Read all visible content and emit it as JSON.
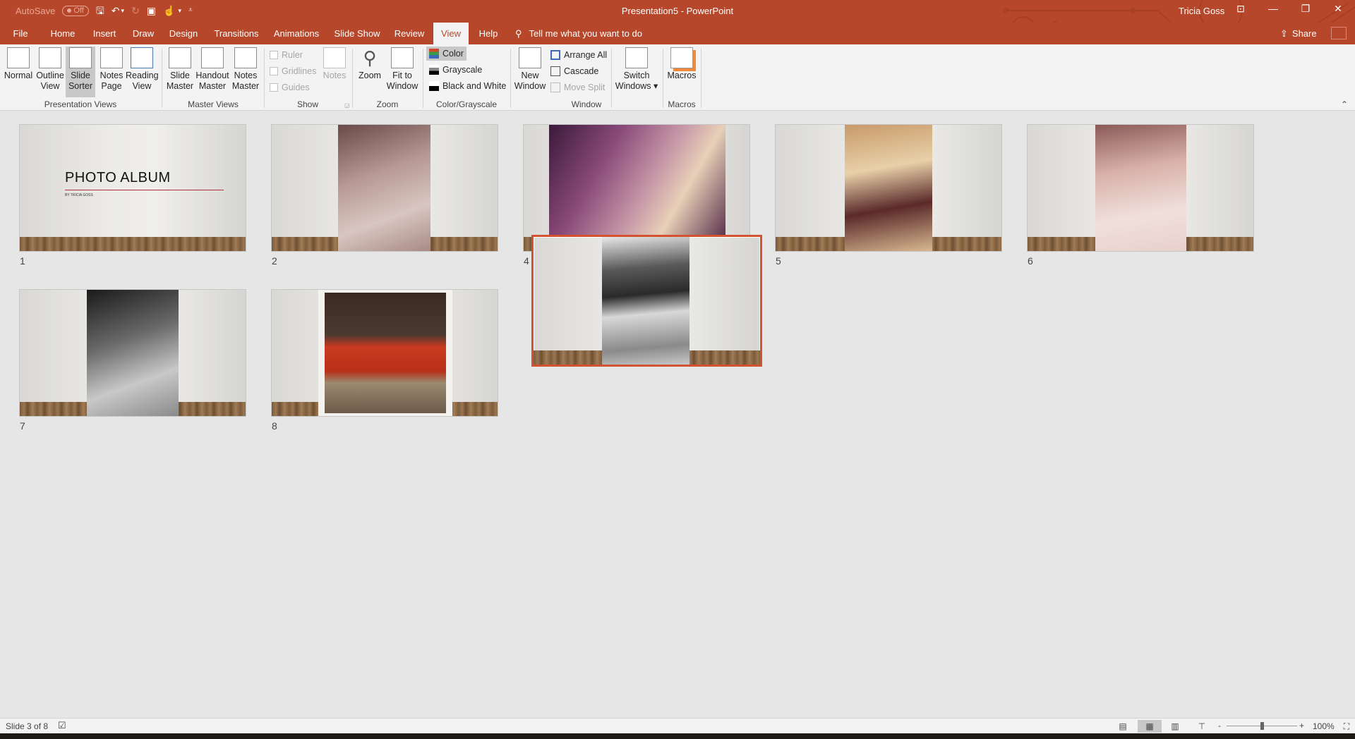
{
  "window": {
    "title": "Presentation5  -  PowerPoint",
    "user": "Tricia Goss",
    "autosave_label": "AutoSave",
    "autosave_state": "Off",
    "controls": {
      "ribbon_display": "⊡",
      "minimize": "—",
      "restore": "❐",
      "close": "✕"
    }
  },
  "qat": {
    "save": "🖫",
    "undo": "↶",
    "undo_dd": "▾",
    "redo": "↻",
    "present": "▣",
    "touch": "☝",
    "touch_dd": "▾",
    "customize": "⩡"
  },
  "tabs": [
    {
      "label": "File"
    },
    {
      "label": "Home"
    },
    {
      "label": "Insert"
    },
    {
      "label": "Draw"
    },
    {
      "label": "Design"
    },
    {
      "label": "Transitions"
    },
    {
      "label": "Animations"
    },
    {
      "label": "Slide Show"
    },
    {
      "label": "Review"
    },
    {
      "label": "View",
      "active": true
    },
    {
      "label": "Help"
    }
  ],
  "tell_me": "Tell me what you want to do",
  "share": "Share",
  "ribbon": {
    "presentation_views": {
      "label": "Presentation Views",
      "items": [
        {
          "l1": "Normal",
          "l2": ""
        },
        {
          "l1": "Outline",
          "l2": "View"
        },
        {
          "l1": "Slide",
          "l2": "Sorter",
          "selected": true
        },
        {
          "l1": "Notes",
          "l2": "Page"
        },
        {
          "l1": "Reading",
          "l2": "View"
        }
      ]
    },
    "master_views": {
      "label": "Master Views",
      "items": [
        {
          "l1": "Slide",
          "l2": "Master"
        },
        {
          "l1": "Handout",
          "l2": "Master"
        },
        {
          "l1": "Notes",
          "l2": "Master"
        }
      ]
    },
    "show": {
      "label": "Show",
      "checkboxes": [
        "Ruler",
        "Gridlines",
        "Guides"
      ],
      "notes": "Notes"
    },
    "zoom": {
      "label": "Zoom",
      "zoom": "Zoom",
      "fit_l1": "Fit to",
      "fit_l2": "Window"
    },
    "color": {
      "label": "Color/Grayscale",
      "options": [
        "Color",
        "Grayscale",
        "Black and White"
      ],
      "selected": "Color"
    },
    "window": {
      "label": "Window",
      "new_l1": "New",
      "new_l2": "Window",
      "arrange_all": "Arrange All",
      "cascade": "Cascade",
      "move_split": "Move Split",
      "switch_l1": "Switch",
      "switch_l2": "Windows ▾"
    },
    "macros": {
      "label": "Macros",
      "button": "Macros"
    },
    "collapse": "⌃"
  },
  "slides": [
    {
      "number": "1",
      "title": "PHOTO ALBUM",
      "subtitle": "BY TRICIA GOSS"
    },
    {
      "number": "2",
      "photo": "sepia family portrait"
    },
    {
      "number": "4",
      "photo": "purple-tinted children photo"
    },
    {
      "number": "5",
      "photo": "sepia mother and child"
    },
    {
      "number": "6",
      "photo": "pink-tinted woman with baby"
    },
    {
      "number": "7",
      "photo": "black and white family portrait"
    },
    {
      "number": "8",
      "photo": "woman in red shirt at table"
    },
    {
      "number": "3",
      "photo": "black and white men and children outdoors",
      "selected": true
    }
  ],
  "status": {
    "slide_info": "Slide 3 of 8",
    "zoom_level": "100%",
    "zoom_minus": "-",
    "zoom_plus": "+",
    "zoom_fraction": 0.5
  }
}
